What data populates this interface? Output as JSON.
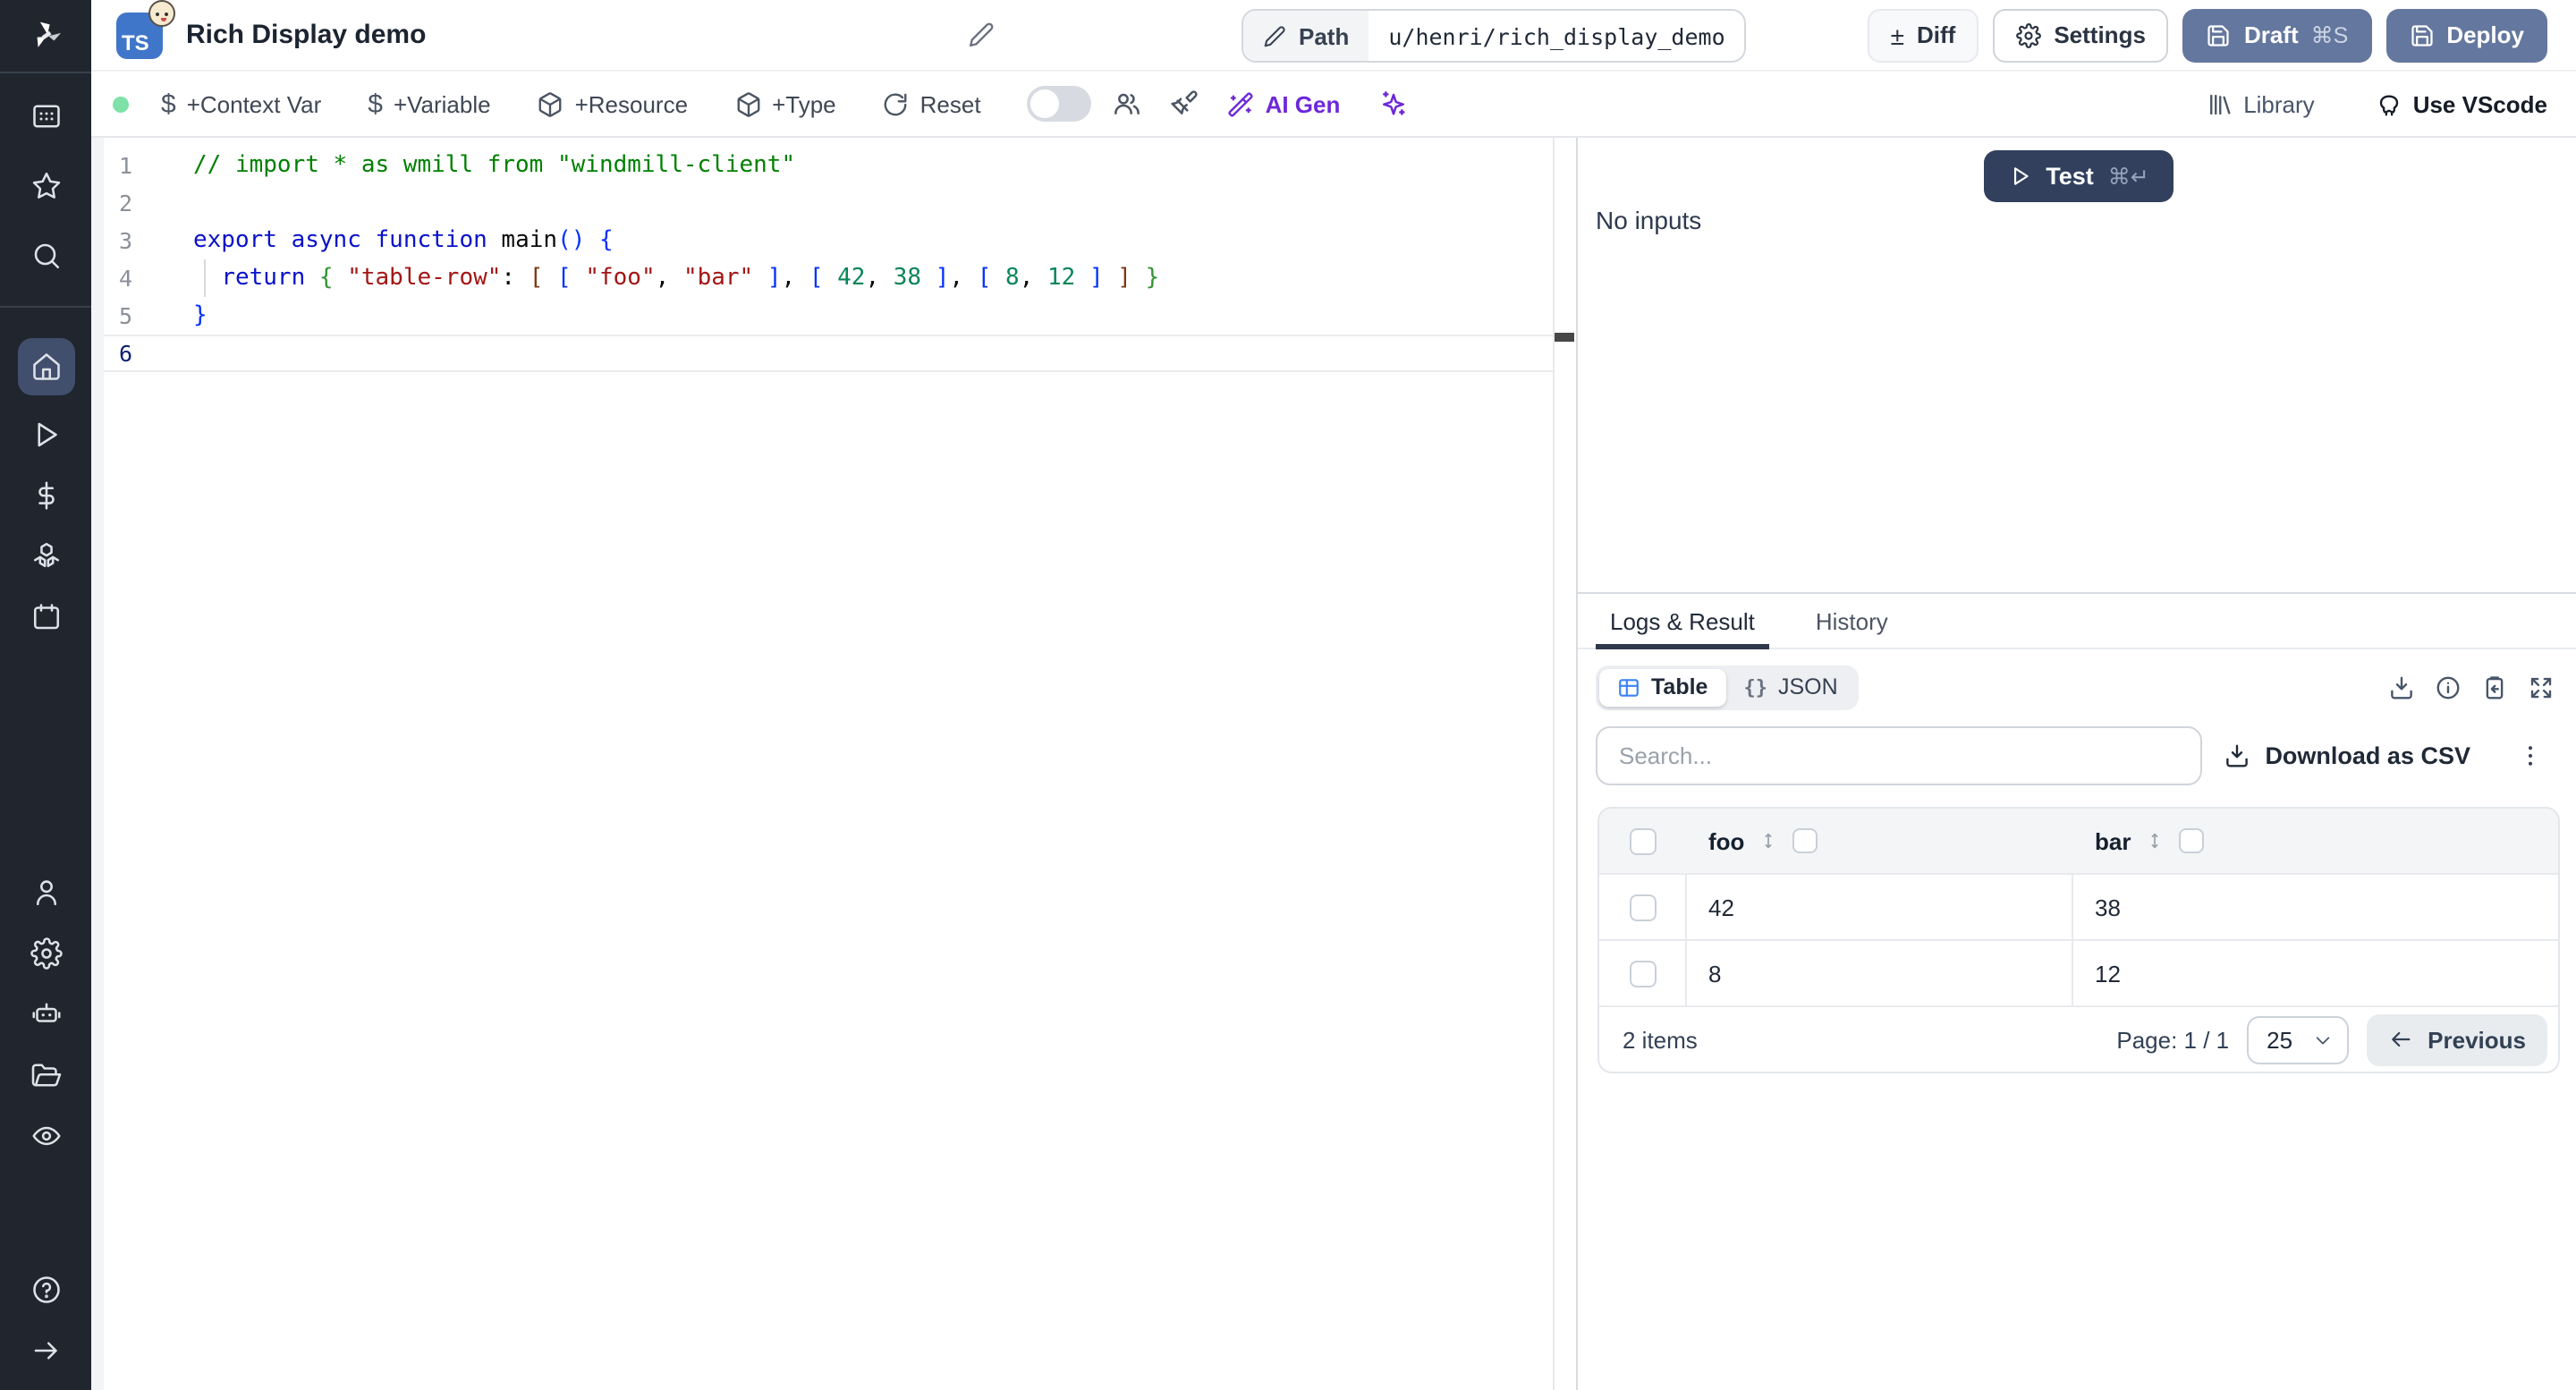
{
  "sidebar": {
    "active_item": "home",
    "items": [
      "windmill-logo",
      "apps",
      "favorites",
      "search",
      "home",
      "runs",
      "variables",
      "resources",
      "schedules",
      "user",
      "settings",
      "workers",
      "folders",
      "audit",
      "help",
      "expand"
    ]
  },
  "titlebar": {
    "language_badge": "TS",
    "runtime_icon": "bun-face",
    "title": "Rich Display demo",
    "path_label": "Path",
    "path_value": "u/henri/rich_display_demo",
    "diff_icon": "±",
    "diff": "Diff",
    "settings": "Settings",
    "draft": "Draft",
    "draft_shortcut": "⌘S",
    "deploy": "Deploy"
  },
  "toolbar": {
    "dollar_glyph": "$",
    "context_var": "+Context Var",
    "variable": "+Variable",
    "resource": "+Resource",
    "type": "+Type",
    "reset": "Reset",
    "ai_gen": "AI Gen",
    "library": "Library",
    "use_vscode": "Use VScode"
  },
  "editor": {
    "line_numbers": [
      "1",
      "2",
      "3",
      "4",
      "5",
      "6"
    ],
    "active_line": 6,
    "lines": [
      {
        "tokens": [
          {
            "t": "// import * as wmill from \"windmill-client\"",
            "c": "comment"
          }
        ]
      },
      {
        "tokens": []
      },
      {
        "tokens": [
          {
            "t": "export",
            "c": "kw"
          },
          {
            "t": " ",
            "c": "plain"
          },
          {
            "t": "async",
            "c": "kw"
          },
          {
            "t": " ",
            "c": "plain"
          },
          {
            "t": "function",
            "c": "kw"
          },
          {
            "t": " main",
            "c": "plain"
          },
          {
            "t": "()",
            "c": "b1"
          },
          {
            "t": " ",
            "c": "plain"
          },
          {
            "t": "{",
            "c": "b1"
          }
        ]
      },
      {
        "tokens": [
          {
            "t": "  ",
            "c": "plain"
          },
          {
            "t": "return",
            "c": "kw"
          },
          {
            "t": " ",
            "c": "plain"
          },
          {
            "t": "{",
            "c": "b2"
          },
          {
            "t": " ",
            "c": "plain"
          },
          {
            "t": "\"table-row\"",
            "c": "str"
          },
          {
            "t": ": ",
            "c": "plain"
          },
          {
            "t": "[",
            "c": "b3"
          },
          {
            "t": " ",
            "c": "plain"
          },
          {
            "t": "[",
            "c": "b1"
          },
          {
            "t": " ",
            "c": "plain"
          },
          {
            "t": "\"foo\"",
            "c": "str"
          },
          {
            "t": ", ",
            "c": "plain"
          },
          {
            "t": "\"bar\"",
            "c": "str"
          },
          {
            "t": " ",
            "c": "plain"
          },
          {
            "t": "]",
            "c": "b1"
          },
          {
            "t": ", ",
            "c": "plain"
          },
          {
            "t": "[",
            "c": "b1"
          },
          {
            "t": " ",
            "c": "plain"
          },
          {
            "t": "42",
            "c": "num"
          },
          {
            "t": ", ",
            "c": "plain"
          },
          {
            "t": "38",
            "c": "num"
          },
          {
            "t": " ",
            "c": "plain"
          },
          {
            "t": "]",
            "c": "b1"
          },
          {
            "t": ", ",
            "c": "plain"
          },
          {
            "t": "[",
            "c": "b1"
          },
          {
            "t": " ",
            "c": "plain"
          },
          {
            "t": "8",
            "c": "num"
          },
          {
            "t": ", ",
            "c": "plain"
          },
          {
            "t": "12",
            "c": "num"
          },
          {
            "t": " ",
            "c": "plain"
          },
          {
            "t": "]",
            "c": "b1"
          },
          {
            "t": " ",
            "c": "plain"
          },
          {
            "t": "]",
            "c": "b3"
          },
          {
            "t": " ",
            "c": "plain"
          },
          {
            "t": "}",
            "c": "b2"
          }
        ]
      },
      {
        "tokens": [
          {
            "t": "}",
            "c": "b1"
          }
        ]
      },
      {
        "tokens": []
      }
    ]
  },
  "run_panel": {
    "test": "Test",
    "test_shortcut": "⌘↵",
    "no_inputs": "No inputs"
  },
  "result_panel": {
    "tabs": [
      {
        "label": "Logs & Result",
        "active": true
      },
      {
        "label": "History",
        "active": false
      }
    ],
    "view_toggle": {
      "table": "Table",
      "json": "JSON",
      "braces_glyph": "{}"
    },
    "kebab_glyph": "⋮",
    "search_placeholder": "Search...",
    "download_csv": "Download as CSV",
    "table": {
      "columns": [
        "foo",
        "bar"
      ],
      "rows": [
        [
          "42",
          "38"
        ],
        [
          "8",
          "12"
        ]
      ],
      "items_count": "2 items",
      "page": "Page: 1 / 1",
      "page_size": "25",
      "previous": "Previous"
    }
  },
  "colors": {
    "primary_button": "#64779e",
    "test_button": "#32405e",
    "ai_accent": "#6d28d9",
    "table_icon_accent": "#3b82f6",
    "status_dot": "#7ee2a8",
    "sidebar_bg": "#20252e",
    "sidebar_active_bg": "#414f6d",
    "ts_badge": "#4076c9"
  }
}
